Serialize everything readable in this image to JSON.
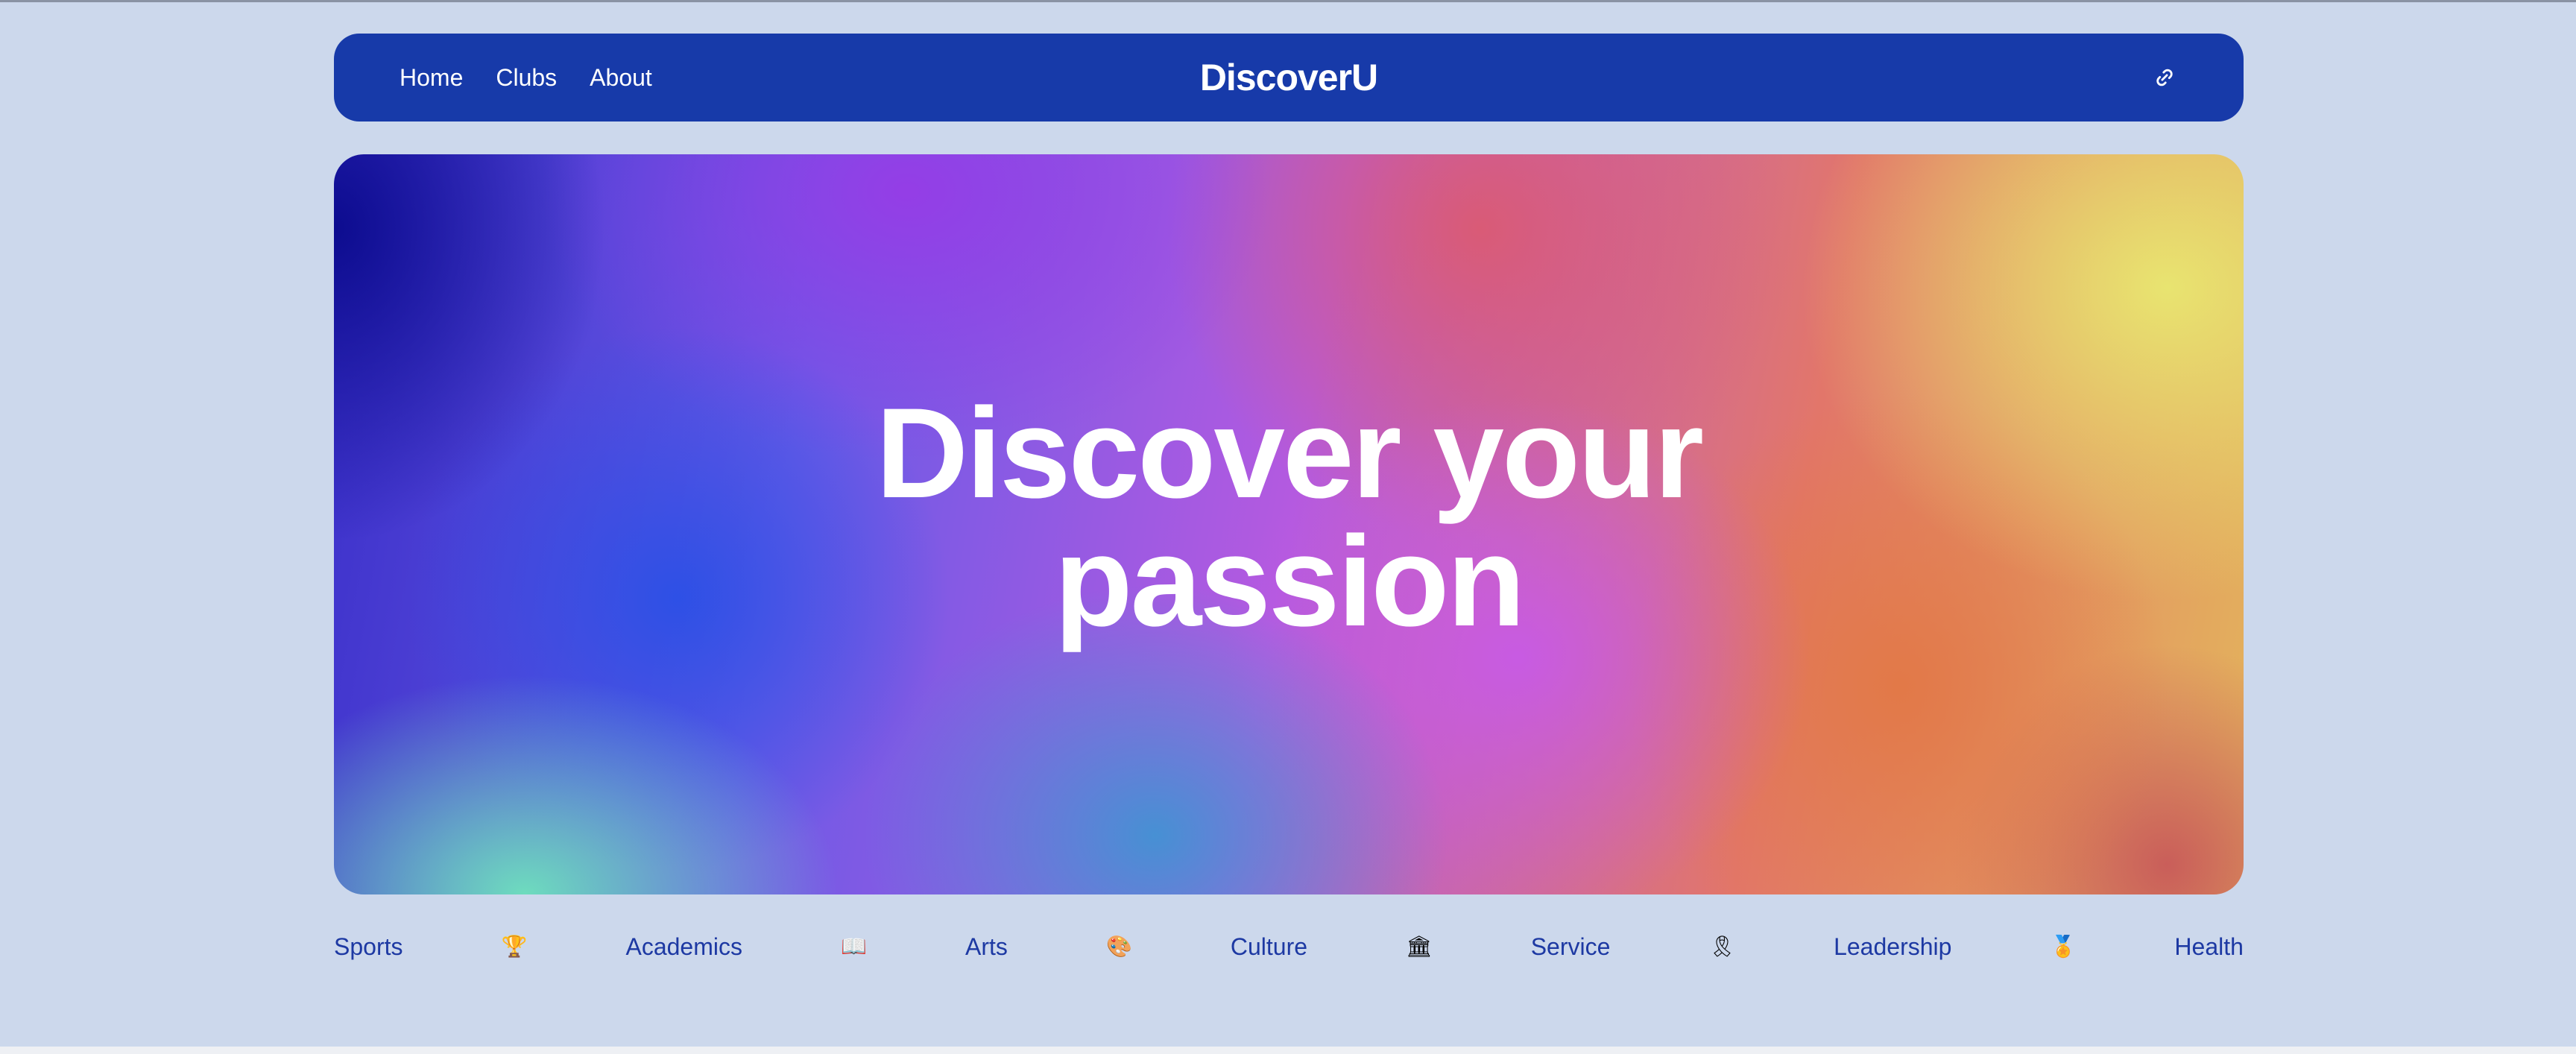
{
  "nav": {
    "links": [
      "Home",
      "Clubs",
      "About"
    ],
    "brand": "DiscoverU",
    "link_icon": "link-icon"
  },
  "hero": {
    "title_line1": "Discover your",
    "title_line2": "passion"
  },
  "categories": {
    "items": [
      {
        "label": "Sports",
        "icon": "trophy-icon",
        "glyph": "🏆"
      },
      {
        "label": "Academics",
        "icon": "open-book-icon",
        "glyph": "📖"
      },
      {
        "label": "Arts",
        "icon": "palette-icon",
        "glyph": "🎨"
      },
      {
        "label": "Culture",
        "icon": "building-icon",
        "glyph": "🏛"
      },
      {
        "label": "Service",
        "icon": "ribbon-icon",
        "glyph": "🎗"
      },
      {
        "label": "Leadership",
        "icon": "medal-icon",
        "glyph": "🏅"
      },
      {
        "label": "Health",
        "icon": "",
        "glyph": ""
      }
    ]
  },
  "colors": {
    "page_background": "#ccd8ec",
    "navbar": "#173aa9",
    "category_text": "#1d39a3"
  }
}
